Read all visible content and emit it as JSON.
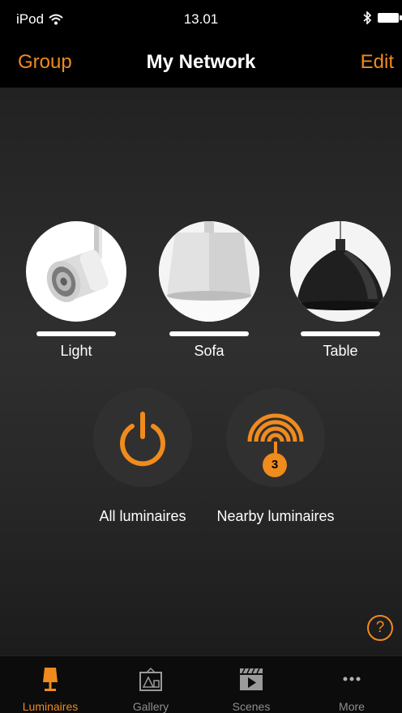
{
  "status_bar": {
    "carrier": "iPod",
    "time": "13.01"
  },
  "nav": {
    "left": "Group",
    "title": "My Network",
    "right": "Edit"
  },
  "luminaires": [
    {
      "label": "Light",
      "icon": "spotlight-icon"
    },
    {
      "label": "Sofa",
      "icon": "drum-pendant-icon"
    },
    {
      "label": "Table",
      "icon": "dome-pendant-icon"
    }
  ],
  "actions": {
    "all": {
      "label": "All luminaires",
      "icon": "power-icon"
    },
    "nearby": {
      "label": "Nearby luminaires",
      "icon": "signal-arcs-icon",
      "badge": "3"
    }
  },
  "help": {
    "symbol": "?"
  },
  "tabs": [
    {
      "label": "Luminaires",
      "icon": "luminaire-icon",
      "active": true
    },
    {
      "label": "Gallery",
      "icon": "gallery-icon",
      "active": false
    },
    {
      "label": "Scenes",
      "icon": "clapperboard-icon",
      "active": false
    },
    {
      "label": "More",
      "icon": "ellipsis-icon",
      "active": false
    }
  ],
  "colors": {
    "accent": "#f08b1d",
    "background": "#2a2a2a",
    "bar": "#000000"
  }
}
